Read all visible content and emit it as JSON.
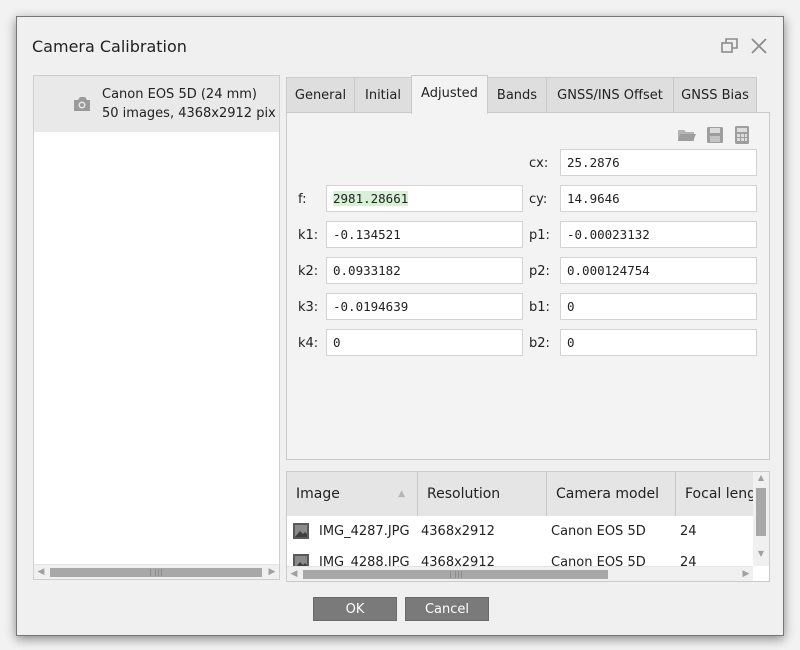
{
  "dialog": {
    "title": "Camera Calibration"
  },
  "camera_list": {
    "items": [
      {
        "name": "Canon EOS 5D (24 mm)",
        "details": "50 images, 4368x2912 pix"
      }
    ]
  },
  "tabs": [
    {
      "label": "General"
    },
    {
      "label": "Initial"
    },
    {
      "label": "Adjusted"
    },
    {
      "label": "Bands"
    },
    {
      "label": "GNSS/INS Offset"
    },
    {
      "label": "GNSS Bias"
    }
  ],
  "active_tab": "Adjusted",
  "params": {
    "cx": {
      "label": "cx:",
      "value": "25.2876"
    },
    "f": {
      "label": "f:",
      "value": "2981.28661"
    },
    "cy": {
      "label": "cy:",
      "value": "14.9646"
    },
    "k1": {
      "label": "k1:",
      "value": "-0.134521"
    },
    "p1": {
      "label": "p1:",
      "value": "-0.00023132"
    },
    "k2": {
      "label": "k2:",
      "value": "0.0933182"
    },
    "p2": {
      "label": "p2:",
      "value": "0.000124754"
    },
    "k3": {
      "label": "k3:",
      "value": "-0.0194639"
    },
    "b1": {
      "label": "b1:",
      "value": "0"
    },
    "k4": {
      "label": "k4:",
      "value": "0"
    },
    "b2": {
      "label": "b2:",
      "value": "0"
    }
  },
  "toolbar_icons": [
    "folder-open-icon",
    "save-icon",
    "calculator-icon"
  ],
  "images_table": {
    "columns": [
      "Image",
      "Resolution",
      "Camera model",
      "Focal length"
    ],
    "rows": [
      {
        "image": "IMG_4287.JPG",
        "resolution": "4368x2912",
        "camera_model": "Canon EOS 5D",
        "focal": "24"
      },
      {
        "image": "IMG_4288.JPG",
        "resolution": "4368x2912",
        "camera_model": "Canon EOS 5D",
        "focal": "24"
      }
    ]
  },
  "buttons": {
    "ok": "OK",
    "cancel": "Cancel"
  },
  "colors": {
    "highlight": "#d6f1d6",
    "button_bg": "#7a7a7a"
  }
}
